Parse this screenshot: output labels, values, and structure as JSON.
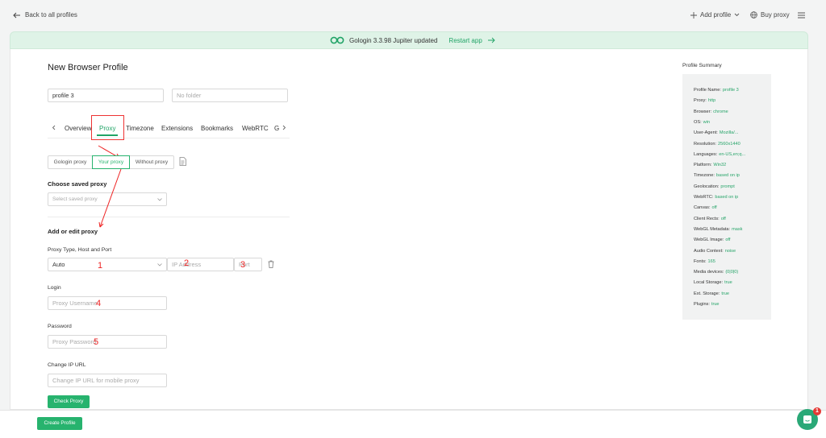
{
  "topbar": {
    "back_label": "Back to all profiles",
    "add_profile_label": "Add profile",
    "buy_proxy_label": "Buy proxy"
  },
  "banner": {
    "message": "Gologin 3.3.98 Jupiter updated",
    "restart_label": "Restart app"
  },
  "page": {
    "title": "New Browser Profile",
    "profile_name_value": "profile 3",
    "folder_placeholder": "No folder"
  },
  "tabs": {
    "items": [
      "Overview",
      "Proxy",
      "Timezone",
      "Extensions",
      "Bookmarks",
      "WebRTC",
      "G"
    ],
    "active": "Proxy"
  },
  "proxy_mode": {
    "options": [
      "Gologin proxy",
      "Your proxy",
      "Without proxy"
    ],
    "active": "Your proxy"
  },
  "saved_proxy": {
    "heading": "Choose saved proxy",
    "placeholder": "Select saved proxy"
  },
  "edit_proxy": {
    "heading": "Add or edit proxy",
    "type_host_port_label": "Proxy Type, Host and Port",
    "type_value": "Auto",
    "ip_placeholder": "IP Address",
    "port_placeholder": "Port",
    "login_label": "Login",
    "username_placeholder": "Proxy Username",
    "password_label": "Password",
    "password_placeholder": "Proxy Password",
    "change_ip_label": "Change IP URL",
    "change_ip_placeholder": "Change IP URL for mobile proxy",
    "check_label": "Check Proxy"
  },
  "annotations": [
    "1",
    "2",
    "3",
    "4",
    "5"
  ],
  "footer": {
    "create_label": "Create Profile",
    "chat_badge": "1"
  },
  "summary": {
    "title": "Profile Summary",
    "rows": [
      {
        "k": "Profile Name:",
        "v": "profile 3"
      },
      {
        "k": "Proxy:",
        "v": "http"
      },
      {
        "k": "Browser:",
        "v": "chrome"
      },
      {
        "k": "OS:",
        "v": "win"
      },
      {
        "k": "User-Agent:",
        "v": "Mozilla/..."
      },
      {
        "k": "Resolution:",
        "v": "2560x1440"
      },
      {
        "k": "Languages:",
        "v": "en-US,en;q..."
      },
      {
        "k": "Platform:",
        "v": "Win32"
      },
      {
        "k": "Timezone:",
        "v": "based on ip"
      },
      {
        "k": "Geolocation:",
        "v": "prompt"
      },
      {
        "k": "WebRTC:",
        "v": "based on ip"
      },
      {
        "k": "Canvas:",
        "v": "off"
      },
      {
        "k": "Client Rects:",
        "v": "off"
      },
      {
        "k": "WebGL Metadata:",
        "v": "mask"
      },
      {
        "k": "WebGL Image:",
        "v": "off"
      },
      {
        "k": "Audio Context:",
        "v": "noise"
      },
      {
        "k": "Fonts:",
        "v": "165"
      },
      {
        "k": "Media devices:",
        "v": "(0|0|0)"
      },
      {
        "k": "Local Storage:",
        "v": "true"
      },
      {
        "k": "Ext. Storage:",
        "v": "true"
      },
      {
        "k": "Plugins:",
        "v": "true"
      }
    ]
  },
  "colors": {
    "accent": "#27b36e",
    "annotation": "#e22222"
  }
}
